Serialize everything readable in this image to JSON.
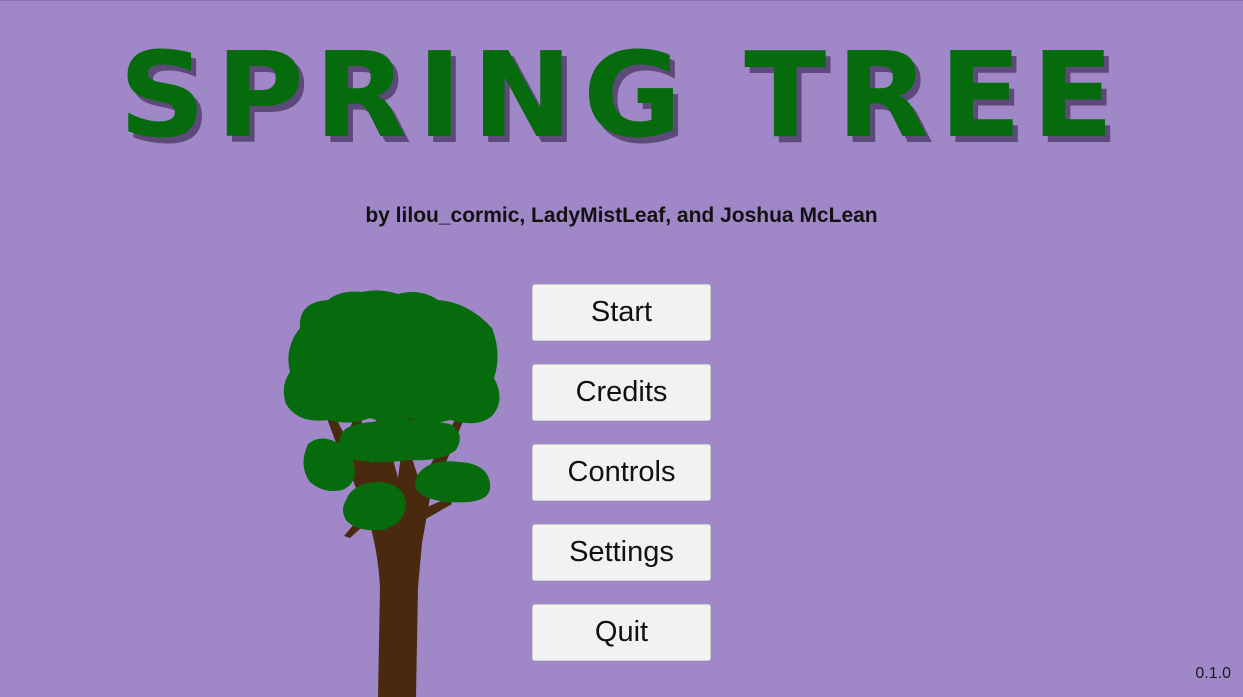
{
  "game": {
    "title": "SPRING TREE",
    "subtitle": "by lilou_cormic, LadyMistLeaf, and Joshua McLean",
    "version": "0.1.0"
  },
  "menu": {
    "start_label": "Start",
    "credits_label": "Credits",
    "controls_label": "Controls",
    "settings_label": "Settings",
    "quit_label": "Quit"
  },
  "colors": {
    "background": "#a088c8",
    "title_green": "#056b0c",
    "title_shadow": "#5e4a7a",
    "foliage": "#056b0c",
    "trunk": "#4a2a0e",
    "button_bg": "#f2f2f2"
  },
  "icons": {
    "tree": "tree-illustration"
  }
}
